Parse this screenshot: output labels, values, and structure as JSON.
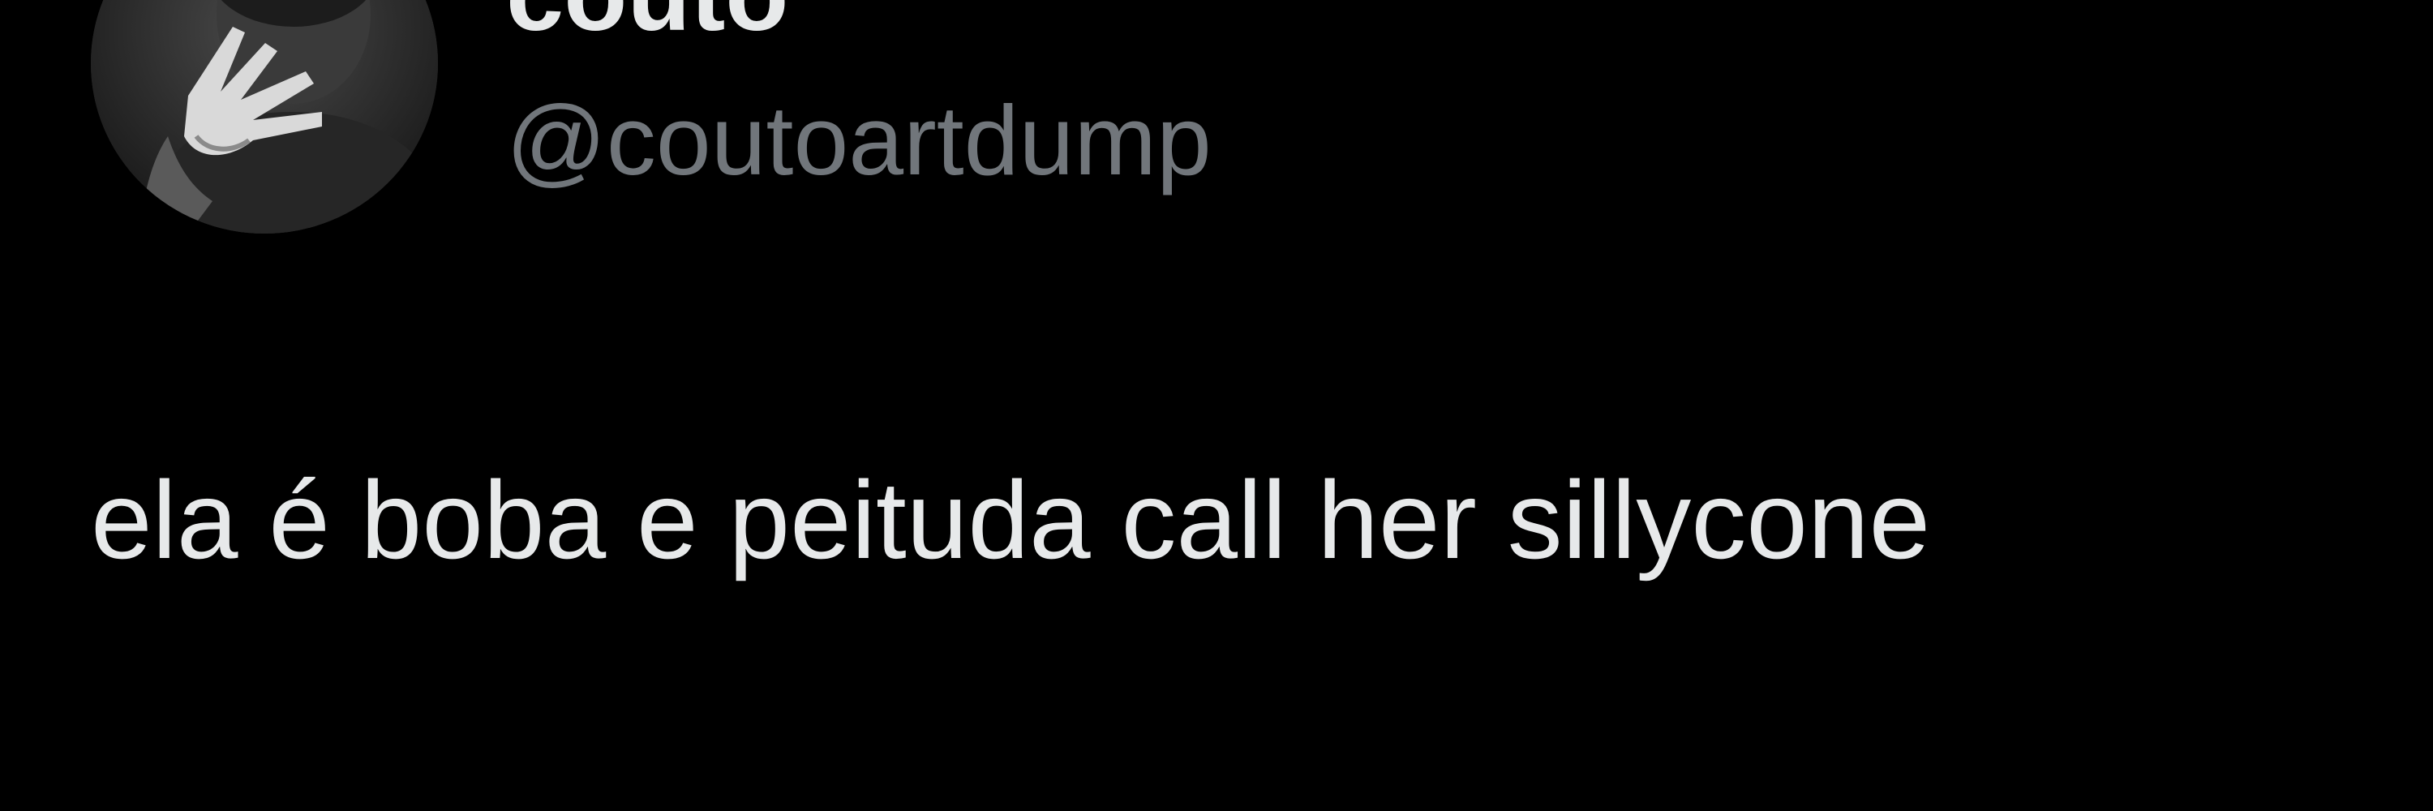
{
  "tweet": {
    "author": {
      "display_name": "couto",
      "handle": "@coutoartdump",
      "avatar": "profile-photo-grayscale"
    },
    "text": "ela é boba e peituda call her sillycone"
  },
  "colors": {
    "background": "#000000",
    "primary_text": "#e7e9ea",
    "secondary_text": "#71767b"
  }
}
